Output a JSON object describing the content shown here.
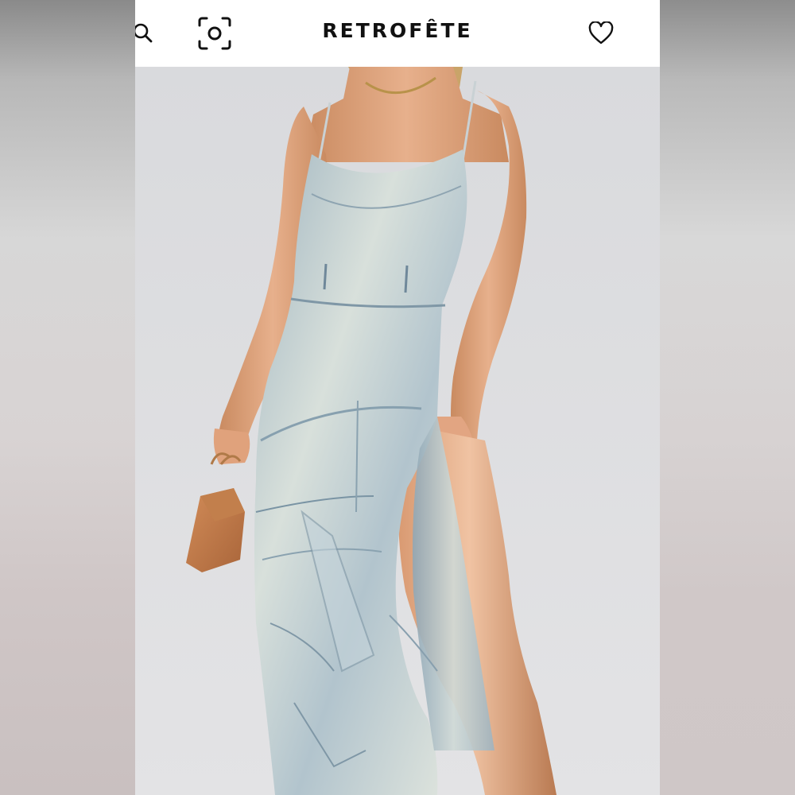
{
  "header": {
    "brand": "RETROFÊTE",
    "icons": [
      "search-icon",
      "camera-scan-icon",
      "heart-icon",
      "bag-icon"
    ]
  },
  "colors": {
    "header_bg": "#ffffff",
    "photo_bg": "#dcdde0",
    "denim": "#b7c5cc",
    "skin": "#e2a27a",
    "handbag": "#c47d4a"
  }
}
